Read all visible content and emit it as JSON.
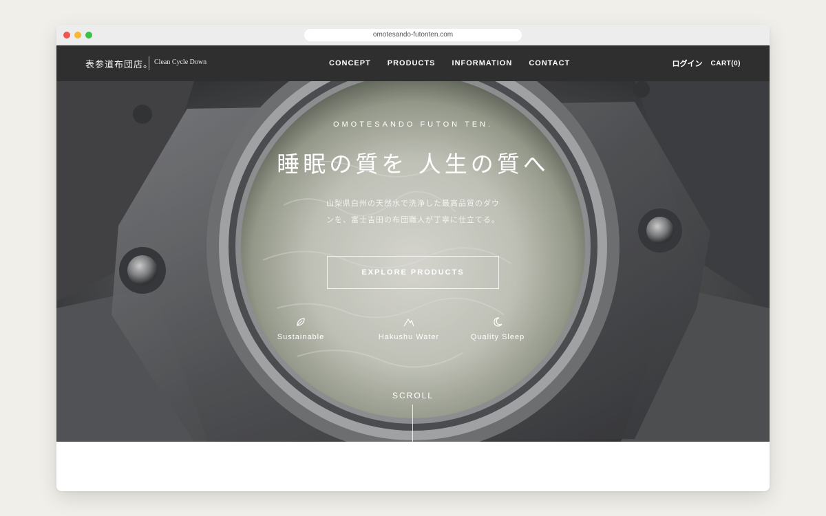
{
  "browser": {
    "url": "omotesando-futonten.com"
  },
  "header": {
    "logo_jp": "表参道布団店。",
    "logo_en": "Clean Cycle Down",
    "menu": [
      {
        "label": "CONCEPT"
      },
      {
        "label": "PRODUCTS"
      },
      {
        "label": "INFORMATION"
      },
      {
        "label": "CONTACT"
      }
    ],
    "login": "ログイン",
    "cart": "CART(0)"
  },
  "hero": {
    "brand": "OMOTESANDO FUTON TEN.",
    "headline": "睡眠の質を 人生の質へ",
    "subline_1": "山梨県白州の天然水で洗浄した最高品質のダウ",
    "subline_2": "ンを、富士吉田の布団職人が丁寧に仕立てる。",
    "cta": "EXPLORE PRODUCTS",
    "features": [
      {
        "label": "Sustainable",
        "icon": "leaf-icon"
      },
      {
        "label": "Hakushu Water",
        "icon": "mountain-icon"
      },
      {
        "label": "Quality Sleep",
        "icon": "moon-icon"
      }
    ],
    "scroll": "SCROLL"
  }
}
